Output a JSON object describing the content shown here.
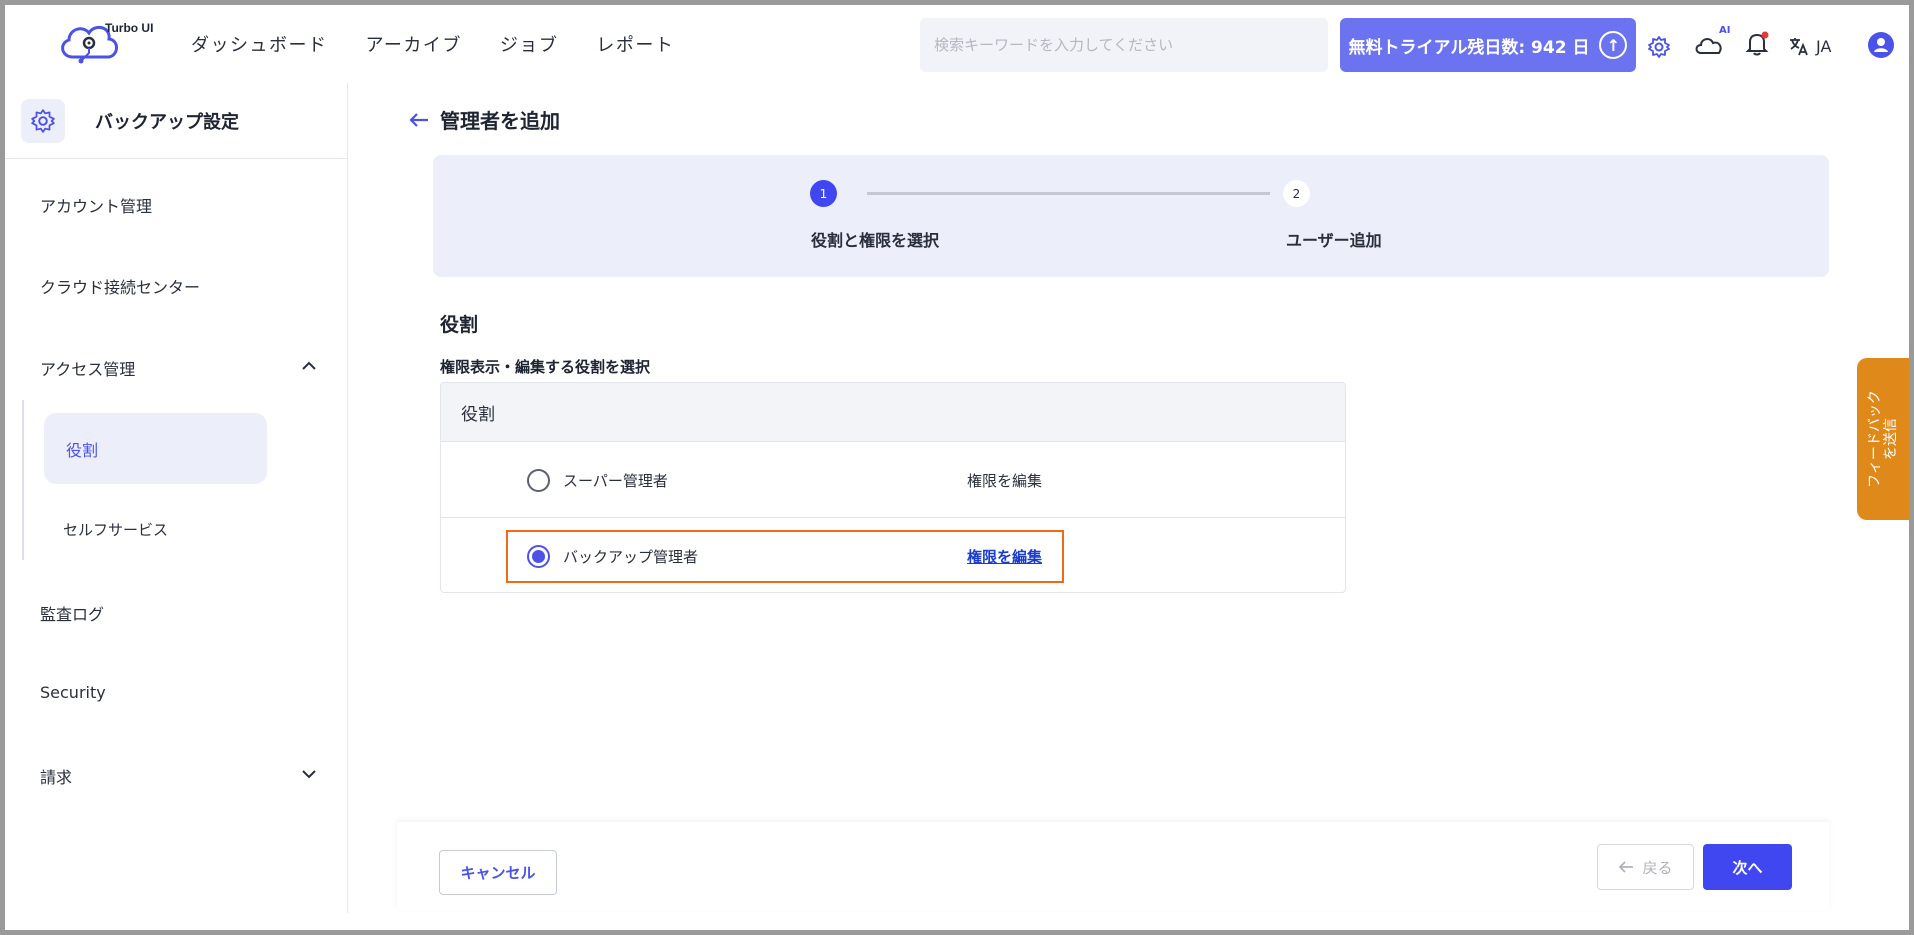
{
  "app": {
    "name": "Turbo UI"
  },
  "nav": [
    "ダッシュボード",
    "アーカイブ",
    "ジョブ",
    "レポート"
  ],
  "search": {
    "placeholder": "検索キーワードを入力してください"
  },
  "trial": {
    "label": "無料トライアル残日数: 942 日"
  },
  "header": {
    "ai_badge": "AI",
    "lang": "JA"
  },
  "sidebar": {
    "title": "バックアップ設定",
    "items": [
      {
        "label": "アカウント管理"
      },
      {
        "label": "クラウド接続センター"
      },
      {
        "label": "アクセス管理"
      },
      {
        "label": "役割"
      },
      {
        "label": "セルフサービス"
      },
      {
        "label": "監査ログ"
      },
      {
        "label": "Security"
      },
      {
        "label": "請求"
      }
    ]
  },
  "main": {
    "title": "管理者を追加",
    "steps": [
      {
        "num": "1",
        "label": "役割と権限を選択"
      },
      {
        "num": "2",
        "label": "ユーザー追加"
      }
    ],
    "section_title": "役割",
    "section_sub": "権限表示・編集する役割を選択",
    "table_header": "役割",
    "roles": [
      {
        "name": "スーパー管理者",
        "action": "権限を編集",
        "selected": false
      },
      {
        "name": "バックアップ管理者",
        "action": "権限を編集",
        "selected": true
      }
    ]
  },
  "footer": {
    "cancel": "キャンセル",
    "back": "戻る",
    "next": "次へ"
  },
  "feedback": {
    "label": "フィードバック\nを送信"
  },
  "colors": {
    "accent": "#4a52e8",
    "trial": "#6b73f0",
    "feedback": "#e0891b",
    "highlight": "#f06a1a"
  }
}
